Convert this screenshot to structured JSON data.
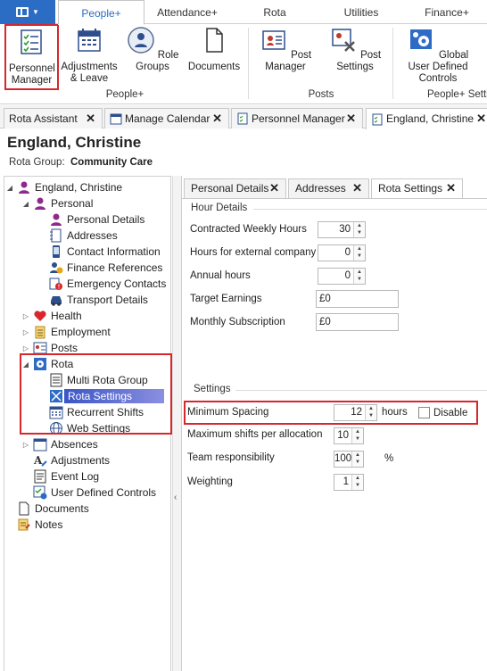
{
  "ribbon_tabs": [
    "People+",
    "Attendance+",
    "Rota",
    "Utilities",
    "Finance+"
  ],
  "ribbon_buttons": {
    "personnel_manager": "Personnel Manager",
    "adjustments": "Adjustments & Leave",
    "role_groups": "Role Groups",
    "documents": "Documents",
    "post_manager": "Post Manager",
    "post_settings": "Post Settings",
    "global_user": "Global User Defined Controls"
  },
  "ribbon_groups": {
    "people": "People+",
    "posts": "Posts",
    "people_settings": "People+ Setti"
  },
  "doc_tabs": [
    "Rota Assistant",
    "Manage Calendar",
    "Personnel Manager",
    "England, Christine"
  ],
  "person": {
    "name": "England, Christine",
    "rota_group_label": "Rota Group:",
    "rota_group_value": "Community Care"
  },
  "tree": {
    "root": "England, Christine",
    "personal": "Personal",
    "personal_details": "Personal Details",
    "addresses": "Addresses",
    "contact_information": "Contact Information",
    "finance_references": "Finance References",
    "emergency_contacts": "Emergency Contacts",
    "transport_details": "Transport Details",
    "health": "Health",
    "employment": "Employment",
    "posts": "Posts",
    "rota": "Rota",
    "multi_rota_group": "Multi Rota Group",
    "rota_settings": "Rota Settings",
    "recurrent_shifts": "Recurrent Shifts",
    "web_settings": "Web Settings",
    "absences": "Absences",
    "adjustments": "Adjustments",
    "event_log": "Event Log",
    "user_defined_controls": "User Defined Controls",
    "documents": "Documents",
    "notes": "Notes"
  },
  "panel_tabs": [
    "Personal Details",
    "Addresses",
    "Rota Settings"
  ],
  "hour_details": {
    "title": "Hour Details",
    "contracted_weekly_hours": {
      "label": "Contracted Weekly Hours",
      "value": "30"
    },
    "hours_external": {
      "label": "Hours for external company",
      "value": "0"
    },
    "annual_hours": {
      "label": "Annual hours",
      "value": "0"
    },
    "target_earnings": {
      "label": "Target Earnings",
      "value": "£0"
    },
    "monthly_subscription": {
      "label": "Monthly Subscription",
      "value": "£0"
    }
  },
  "settings": {
    "title": "Settings",
    "minimum_spacing": {
      "label": "Minimum Spacing",
      "value": "12",
      "unit": "hours",
      "disable_label": "Disable"
    },
    "max_shifts": {
      "label": "Maximum shifts per allocation",
      "value": "10"
    },
    "team_responsibility": {
      "label": "Team responsibility",
      "value": "100",
      "unit": "%"
    },
    "weighting": {
      "label": "Weighting",
      "value": "1"
    }
  },
  "colors": {
    "accent": "#2b6cc4",
    "highlight_border": "#d9262b"
  }
}
